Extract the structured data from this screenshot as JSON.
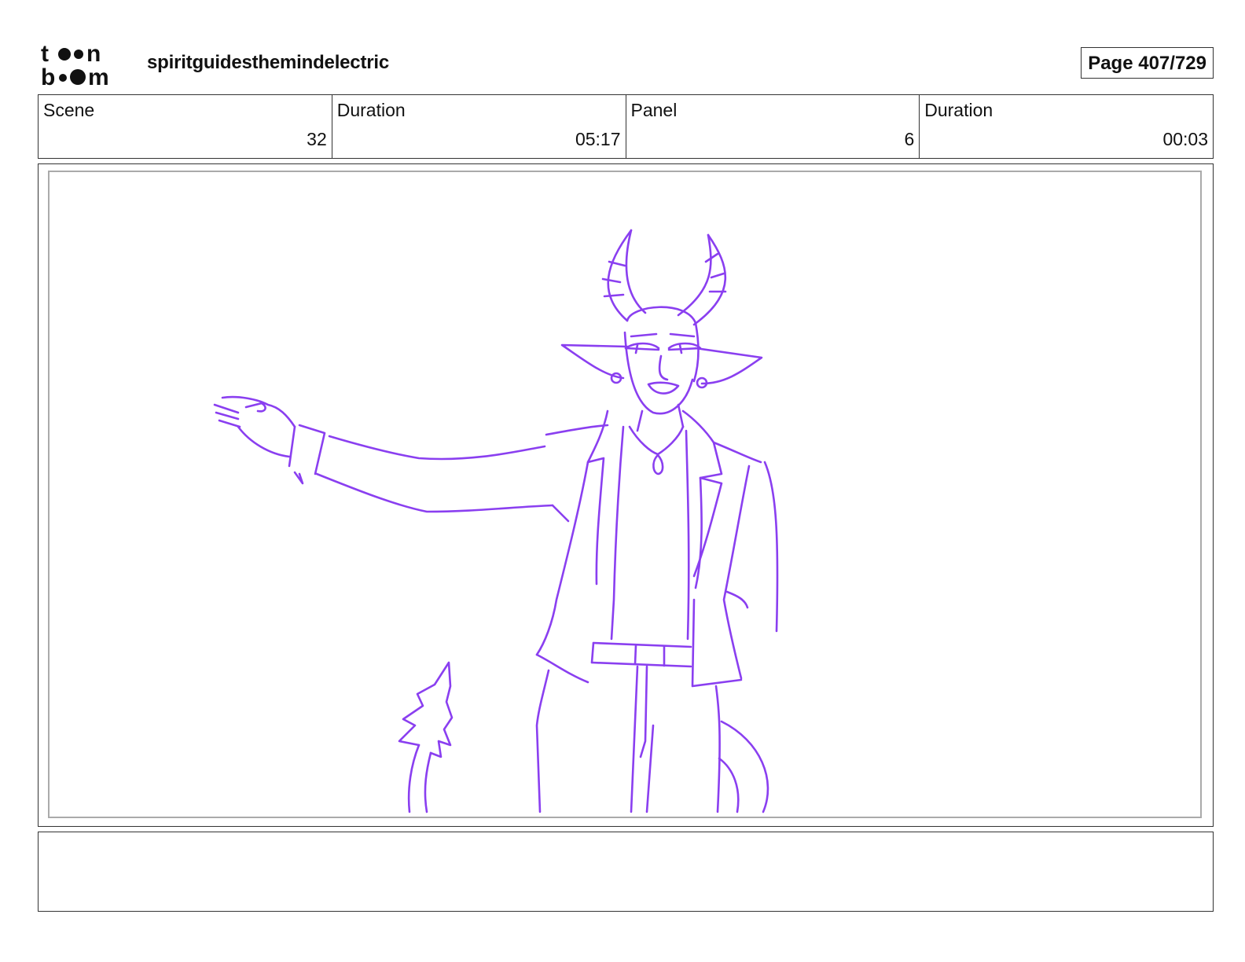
{
  "header": {
    "logo_text_top": "toon",
    "logo_text_bottom": "boom",
    "project_title": "spiritguidesthemindelectric",
    "page_label": "Page 407/729"
  },
  "info": {
    "scene_label": "Scene",
    "scene_value": "32",
    "scene_duration_label": "Duration",
    "scene_duration_value": "05:17",
    "panel_label": "Panel",
    "panel_value": "6",
    "panel_duration_label": "Duration",
    "panel_duration_value": "00:03"
  },
  "notes": {
    "text": ""
  },
  "colors": {
    "sketch_stroke": "#8a3ff0",
    "border": "#333333",
    "inner_border": "#aaaaaa"
  }
}
